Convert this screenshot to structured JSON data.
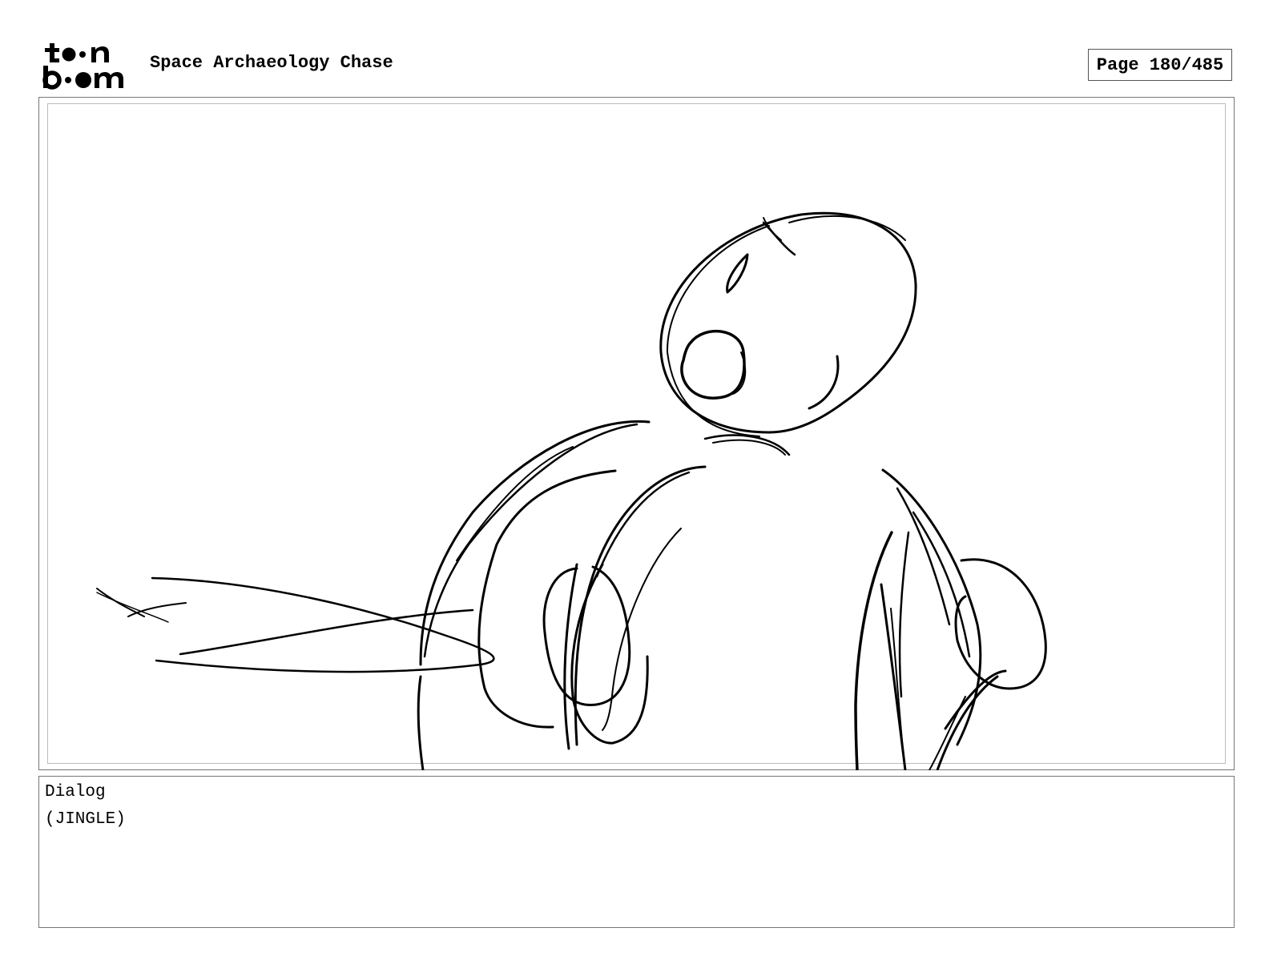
{
  "header": {
    "logo_line1": "toon",
    "logo_line2": "boom",
    "project_title": "Space Archaeology Chase",
    "page_counter": "Page 180/485"
  },
  "dialog": {
    "label": "Dialog",
    "text": "(JINGLE)"
  }
}
